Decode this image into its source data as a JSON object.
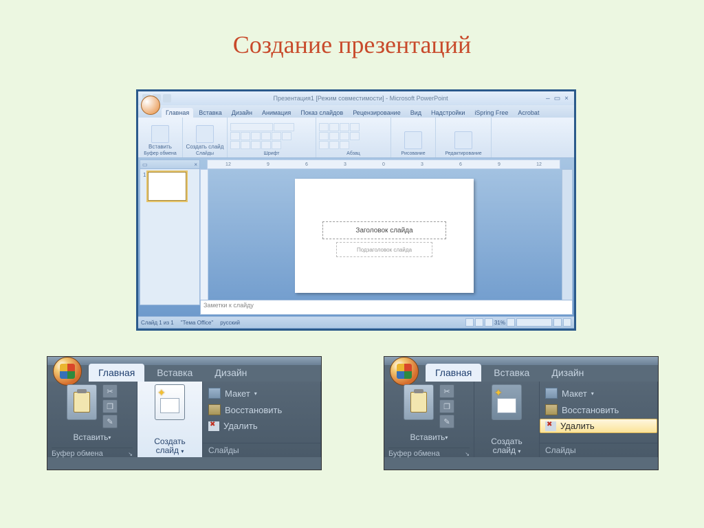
{
  "page": {
    "title": "Создание презентаций"
  },
  "main_window": {
    "title_text": "Презентация1 [Режим совместимости] - Microsoft PowerPoint",
    "win_min": "–",
    "win_max": "▭",
    "win_close": "×",
    "tabs": {
      "home": "Главная",
      "insert": "Вставка",
      "design": "Дизайн",
      "anim": "Анимация",
      "slideshow": "Показ слайдов",
      "review": "Рецензирование",
      "view": "Вид",
      "addins": "Надстройки",
      "ispring": "iSpring Free",
      "acrobat": "Acrobat"
    },
    "groups": {
      "paste": "Вставить",
      "clipboard": "Буфер обмена",
      "newslide": "Создать слайд",
      "slides": "Слайды",
      "font": "Шрифт",
      "para": "Абзац",
      "drawing": "Рисование",
      "editing": "Редактирование"
    },
    "ruler_marks": [
      "12",
      "9",
      "6",
      "3",
      "0",
      "3",
      "6",
      "9",
      "12"
    ],
    "slide": {
      "title_ph": "Заголовок слайда",
      "sub_ph": "Подзаголовок слайда"
    },
    "notes": "Заметки к слайду",
    "status": {
      "slide_info": "Слайд 1 из 1",
      "theme": "\"Тема Office\"",
      "lang": "русский",
      "zoom": "31%"
    }
  },
  "zoom_snip": {
    "tabs": {
      "home": "Главная",
      "insert": "Вставка",
      "design": "Дизайн"
    },
    "paste": "Вставить",
    "clipboard": "Буфер обмена",
    "newslide_l1": "Создать",
    "newslide_l2": "слайд",
    "menu": {
      "layout": "Макет",
      "restore": "Восстановить",
      "delete": "Удалить",
      "slides": "Слайды"
    }
  }
}
